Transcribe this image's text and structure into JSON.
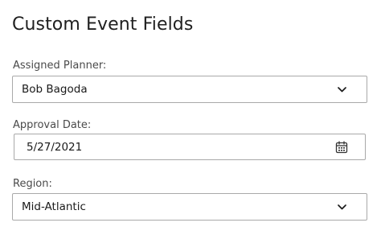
{
  "page": {
    "title": "Custom Event Fields"
  },
  "fields": {
    "assigned_planner": {
      "label": "Assigned Planner:",
      "value": "Bob Bagoda",
      "icon": "chevron-down-icon"
    },
    "approval_date": {
      "label": "Approval Date:",
      "value": "5/27/2021",
      "icon": "calendar-icon"
    },
    "region": {
      "label": "Region:",
      "value": "Mid-Atlantic",
      "icon": "chevron-down-icon"
    }
  },
  "colors": {
    "border": "#a9a9a9",
    "label": "#4a4a4a",
    "text": "#1a1a1a"
  }
}
